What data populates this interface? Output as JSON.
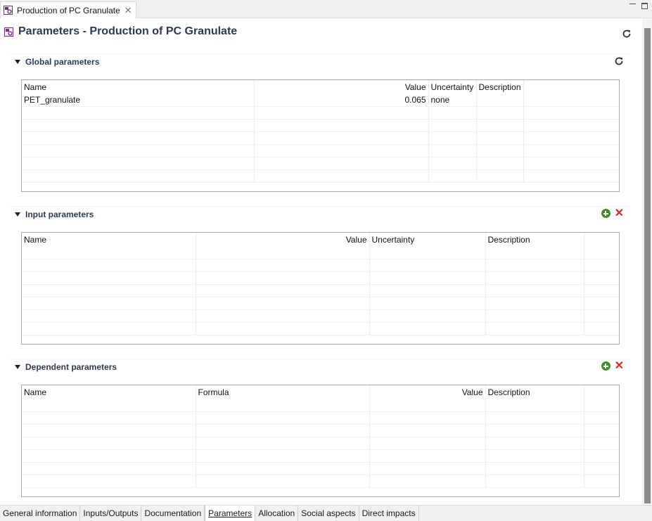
{
  "editor_tab": {
    "title": "Production of PC Granulate",
    "close_glyph": "✕"
  },
  "header": {
    "title": "Parameters - Production of PC Granulate"
  },
  "colors": {
    "title_text": "#2b3a55",
    "add_green": "#3b8f27",
    "delete_red": "#e0262a"
  },
  "global": {
    "title": "Global parameters",
    "columns": [
      "Name",
      "Value",
      "Uncertainty",
      "Description"
    ],
    "rows": [
      {
        "name": "PET_granulate",
        "value": "0.065",
        "uncertainty": "none",
        "description": ""
      }
    ]
  },
  "input": {
    "title": "Input parameters",
    "columns": [
      "Name",
      "Value",
      "Uncertainty",
      "Description"
    ]
  },
  "dependent": {
    "title": "Dependent parameters",
    "columns": [
      "Name",
      "Formula",
      "Value",
      "Description"
    ]
  },
  "page_tabs": [
    "General information",
    "Inputs/Outputs",
    "Documentation",
    "Parameters",
    "Allocation",
    "Social aspects",
    "Direct impacts"
  ],
  "active_page_tab": "Parameters",
  "icons": {
    "process": "process-icon",
    "refresh": "refresh-icon",
    "add": "add-icon",
    "delete": "delete-icon",
    "collapse": "twisty-down-icon"
  }
}
